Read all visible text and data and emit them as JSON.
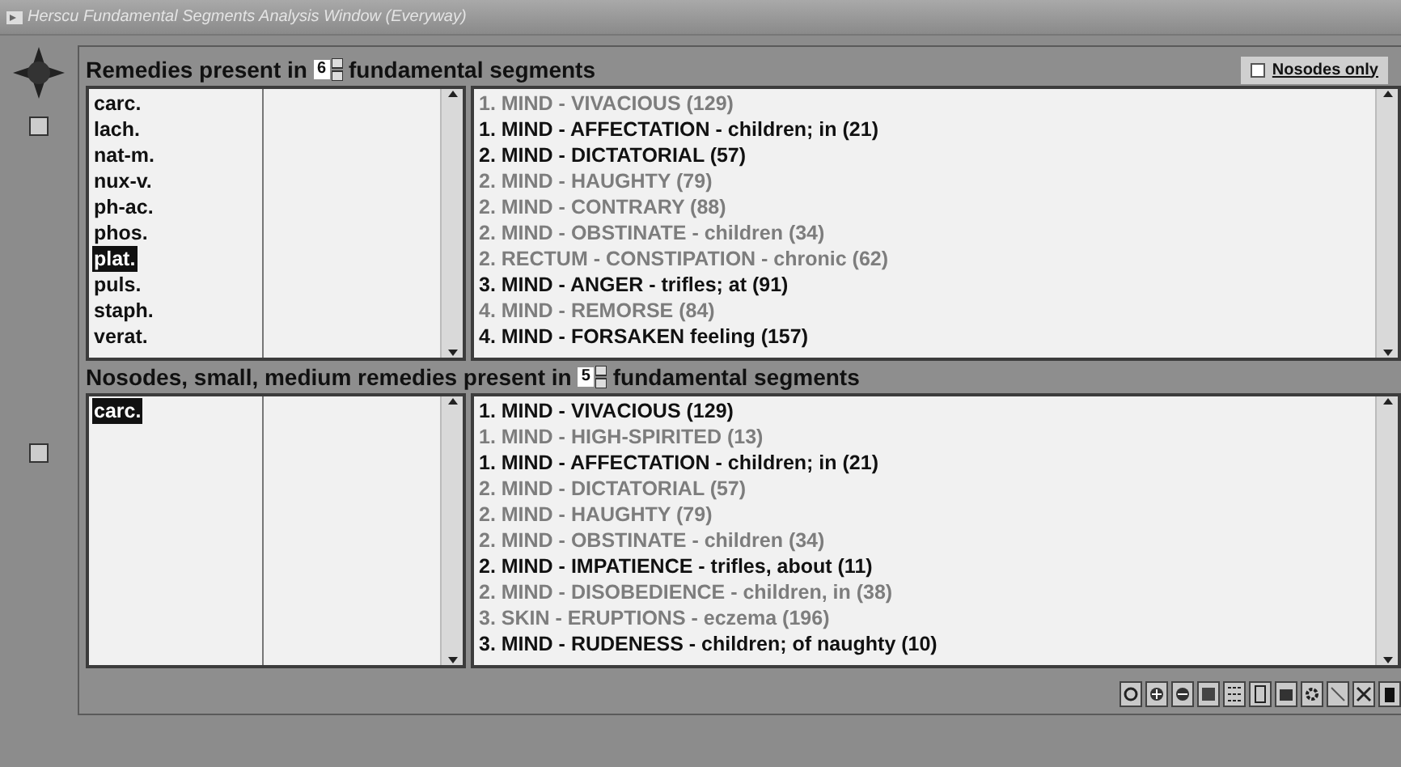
{
  "window": {
    "title": "Herscu Fundamental Segments Analysis Window (Everyway)"
  },
  "nosodes_only": {
    "label": "Nosodes only",
    "checked": false
  },
  "sections": [
    {
      "heading_before": "Remedies present in",
      "count": "6",
      "heading_after": "fundamental segments",
      "remedies": [
        {
          "name": "carc.",
          "selected": false
        },
        {
          "name": "lach.",
          "selected": false
        },
        {
          "name": "nat-m.",
          "selected": false
        },
        {
          "name": "nux-v.",
          "selected": false
        },
        {
          "name": "ph-ac.",
          "selected": false
        },
        {
          "name": "phos.",
          "selected": false
        },
        {
          "name": "plat.",
          "selected": true
        },
        {
          "name": "puls.",
          "selected": false
        },
        {
          "name": "staph.",
          "selected": false
        },
        {
          "name": "verat.",
          "selected": false
        }
      ],
      "rubrics": [
        {
          "text": "1. MIND - VIVACIOUS (129)",
          "emphasized": false
        },
        {
          "text": "1. MIND - AFFECTATION - children; in (21)",
          "emphasized": true
        },
        {
          "text": "2. MIND - DICTATORIAL (57)",
          "emphasized": true
        },
        {
          "text": "2. MIND - HAUGHTY (79)",
          "emphasized": false
        },
        {
          "text": "2. MIND - CONTRARY (88)",
          "emphasized": false
        },
        {
          "text": "2. MIND - OBSTINATE - children (34)",
          "emphasized": false
        },
        {
          "text": "2. RECTUM - CONSTIPATION - chronic (62)",
          "emphasized": false
        },
        {
          "text": "3. MIND - ANGER - trifles; at (91)",
          "emphasized": true
        },
        {
          "text": "4. MIND - REMORSE (84)",
          "emphasized": false
        },
        {
          "text": "4. MIND - FORSAKEN feeling (157)",
          "emphasized": true
        }
      ]
    },
    {
      "heading_before": "Nosodes, small, medium remedies present in",
      "count": "5",
      "heading_after": "fundamental segments",
      "remedies": [
        {
          "name": "carc.",
          "selected": true
        }
      ],
      "rubrics": [
        {
          "text": "1. MIND - VIVACIOUS (129)",
          "emphasized": true
        },
        {
          "text": "1. MIND - HIGH-SPIRITED (13)",
          "emphasized": false
        },
        {
          "text": "1. MIND - AFFECTATION - children; in (21)",
          "emphasized": true
        },
        {
          "text": "2. MIND - DICTATORIAL (57)",
          "emphasized": false
        },
        {
          "text": "2. MIND - HAUGHTY (79)",
          "emphasized": false
        },
        {
          "text": "2. MIND - OBSTINATE - children (34)",
          "emphasized": false
        },
        {
          "text": "2. MIND - IMPATIENCE - trifles, about (11)",
          "emphasized": true
        },
        {
          "text": "2. MIND - DISOBEDIENCE - children, in (38)",
          "emphasized": false
        },
        {
          "text": "3. SKIN - ERUPTIONS - eczema (196)",
          "emphasized": false
        },
        {
          "text": "3. MIND - RUDENESS - children; of naughty (10)",
          "emphasized": true
        }
      ]
    }
  ]
}
